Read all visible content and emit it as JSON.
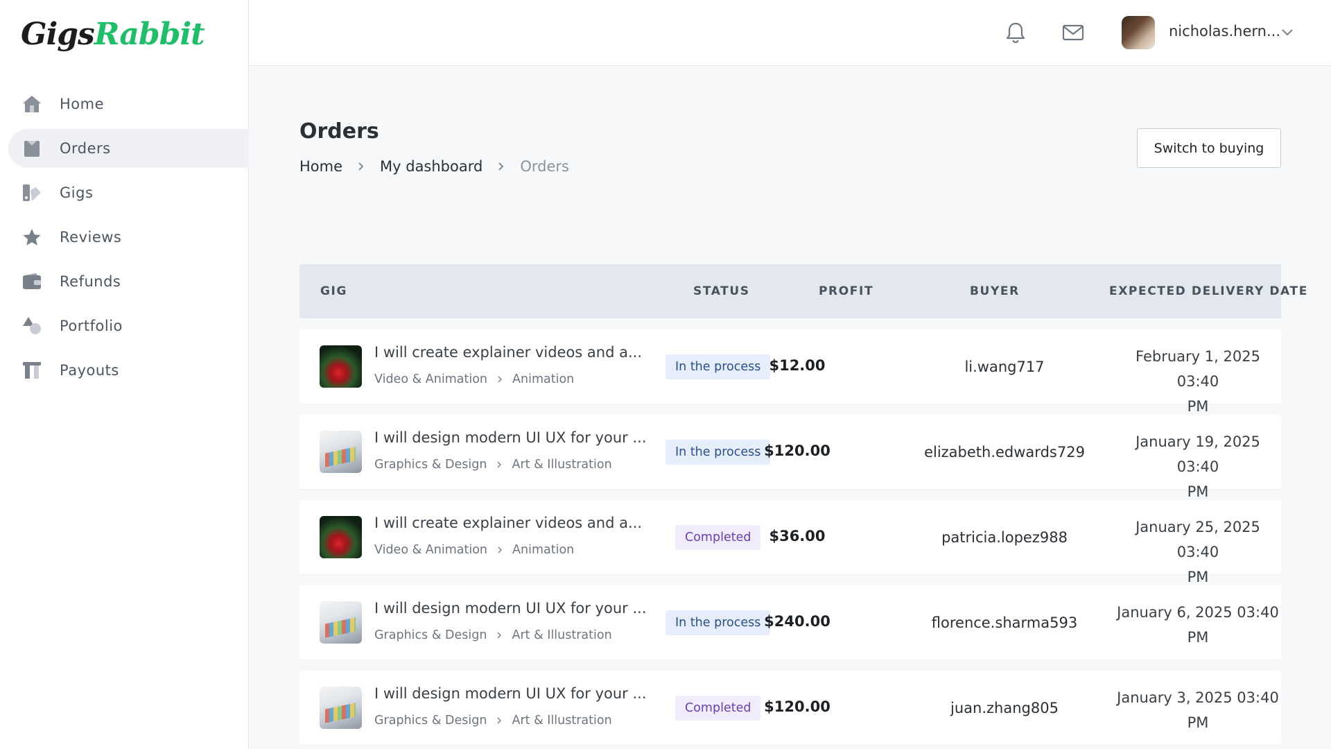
{
  "app": {
    "logo_part1": "Gigs",
    "logo_part2": "Rabbit",
    "brand_color": "#1fbf6a"
  },
  "sidebar": {
    "items": [
      {
        "label": "Home",
        "icon": "home-icon",
        "active": false
      },
      {
        "label": "Orders",
        "icon": "orders-icon",
        "active": true
      },
      {
        "label": "Gigs",
        "icon": "gigs-icon",
        "active": false
      },
      {
        "label": "Reviews",
        "icon": "star-icon",
        "active": false
      },
      {
        "label": "Refunds",
        "icon": "wallet-icon",
        "active": false
      },
      {
        "label": "Portfolio",
        "icon": "shapes-icon",
        "active": false
      },
      {
        "label": "Payouts",
        "icon": "payouts-icon",
        "active": false
      }
    ]
  },
  "topbar": {
    "username": "nicholas.hern...",
    "icons": [
      "bell-icon",
      "mail-icon",
      "chevron-down-icon"
    ]
  },
  "page": {
    "title": "Orders",
    "breadcrumb": [
      "Home",
      "My dashboard",
      "Orders"
    ],
    "switch_button": "Switch to buying"
  },
  "table": {
    "headers": {
      "gig": "GIG",
      "status": "STATUS",
      "profit": "PROFIT",
      "buyer": "BUYER",
      "delivery": "EXPECTED DELIVERY DATE"
    },
    "rows": [
      {
        "thumb": "video",
        "title": "I will create explainer videos and a...",
        "category": "Video & Animation",
        "subcategory": "Animation",
        "status": "In the process",
        "profit": "$12.00",
        "buyer": "li.wang717",
        "delivery_line1": "February 1, 2025 03:40",
        "delivery_line2": "PM"
      },
      {
        "thumb": "design",
        "title": "I will design modern UI UX for your ...",
        "category": "Graphics & Design",
        "subcategory": "Art & Illustration",
        "status": "In the process",
        "profit": "$120.00",
        "buyer": "elizabeth.edwards729",
        "delivery_line1": "January 19, 2025 03:40",
        "delivery_line2": "PM"
      },
      {
        "thumb": "video",
        "title": "I will create explainer videos and a...",
        "category": "Video & Animation",
        "subcategory": "Animation",
        "status": "Completed",
        "profit": "$36.00",
        "buyer": "patricia.lopez988",
        "delivery_line1": "January 25, 2025 03:40",
        "delivery_line2": "PM"
      },
      {
        "thumb": "design",
        "title": "I will design modern UI UX for your ...",
        "category": "Graphics & Design",
        "subcategory": "Art & Illustration",
        "status": "In the process",
        "profit": "$240.00",
        "buyer": "florence.sharma593",
        "delivery_line1": "January 6, 2025 03:40",
        "delivery_line2": "PM"
      },
      {
        "thumb": "design",
        "title": "I will design modern UI UX for your ...",
        "category": "Graphics & Design",
        "subcategory": "Art & Illustration",
        "status": "Completed",
        "profit": "$120.00",
        "buyer": "juan.zhang805",
        "delivery_line1": "January 3, 2025 03:40",
        "delivery_line2": "PM"
      }
    ]
  }
}
